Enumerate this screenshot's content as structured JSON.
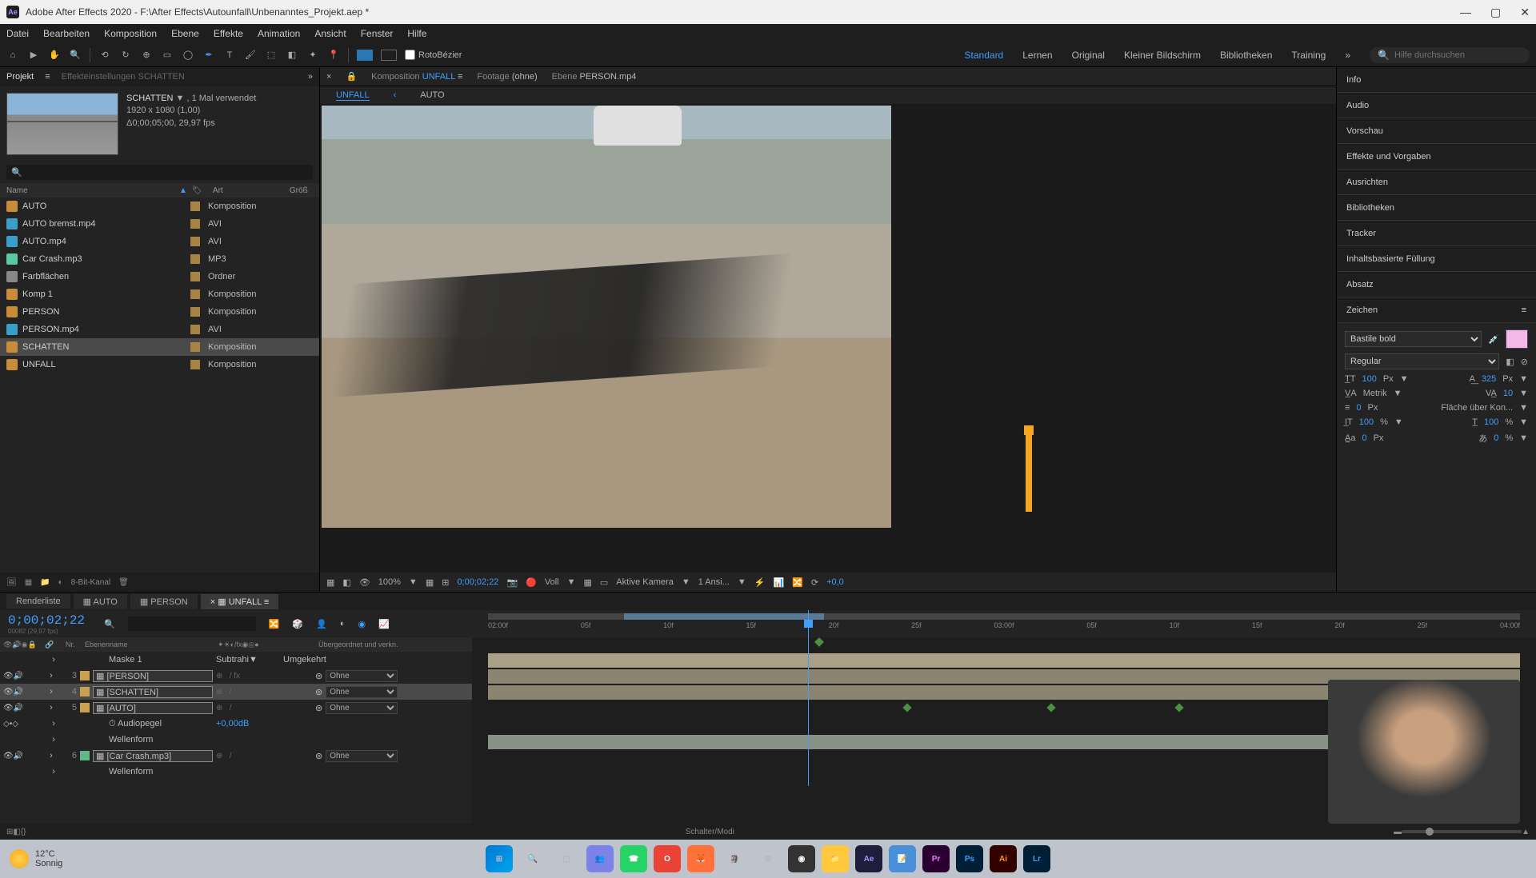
{
  "titlebar": {
    "app": "Ae",
    "title": "Adobe After Effects 2020 - F:\\After Effects\\Autounfall\\Unbenanntes_Projekt.aep *"
  },
  "menu": [
    "Datei",
    "Bearbeiten",
    "Komposition",
    "Ebene",
    "Effekte",
    "Animation",
    "Ansicht",
    "Fenster",
    "Hilfe"
  ],
  "toolbar": {
    "rotobezier": "RotoBézier",
    "workspaces": {
      "items": [
        "Standard",
        "Lernen",
        "Original",
        "Kleiner Bildschirm",
        "Bibliotheken",
        "Training"
      ],
      "active": "Standard"
    },
    "search_placeholder": "Hilfe durchsuchen"
  },
  "project": {
    "tab_label": "Projekt",
    "effect_tab": "Effekteinstellungen SCHATTEN",
    "selected": {
      "name": "SCHATTEN",
      "usage": ", 1 Mal verwendet",
      "res": "1920 x 1080 (1,00)",
      "dur": "Δ0;00;05;00, 29,97 fps"
    },
    "cols": {
      "name": "Name",
      "art": "Art",
      "size": "Größ"
    },
    "items": [
      {
        "name": "AUTO",
        "kind": "comp",
        "art": "Komposition"
      },
      {
        "name": "AUTO bremst.mp4",
        "kind": "vid",
        "art": "AVI"
      },
      {
        "name": "AUTO.mp4",
        "kind": "vid",
        "art": "AVI"
      },
      {
        "name": "Car Crash.mp3",
        "kind": "aud",
        "art": "MP3"
      },
      {
        "name": "Farbflächen",
        "kind": "fold",
        "art": "Ordner"
      },
      {
        "name": "Komp 1",
        "kind": "comp",
        "art": "Komposition"
      },
      {
        "name": "PERSON",
        "kind": "comp",
        "art": "Komposition"
      },
      {
        "name": "PERSON.mp4",
        "kind": "vid",
        "art": "AVI"
      },
      {
        "name": "SCHATTEN",
        "kind": "comp",
        "art": "Komposition",
        "selected": true
      },
      {
        "name": "UNFALL",
        "kind": "comp",
        "art": "Komposition"
      }
    ],
    "footer": "8-Bit-Kanal"
  },
  "composition": {
    "tabs": [
      {
        "label": "Komposition",
        "value": "UNFALL"
      },
      {
        "label": "Footage",
        "value": "(ohne)"
      },
      {
        "label": "Ebene",
        "value": "PERSON.mp4"
      }
    ],
    "subtabs": {
      "active": "UNFALL",
      "other": "AUTO"
    },
    "bar": {
      "zoom": "100%",
      "time": "0;00;02;22",
      "res": "Voll",
      "camera": "Aktive Kamera",
      "views": "1 Ansi...",
      "exposure": "+0,0"
    }
  },
  "panels": [
    "Info",
    "Audio",
    "Vorschau",
    "Effekte und Vorgaben",
    "Ausrichten",
    "Bibliotheken",
    "Tracker",
    "Inhaltsbasierte Füllung",
    "Absatz"
  ],
  "character": {
    "title": "Zeichen",
    "font": "Bastile bold",
    "style": "Regular",
    "size": "100",
    "size_unit": "Px",
    "leading": "325",
    "leading_unit": "Px",
    "kerning": "Metrik",
    "tracking": "10",
    "stroke": "0",
    "stroke_unit": "Px",
    "fill_over": "Fläche über Kon...",
    "vscale": "100",
    "vscale_unit": "%",
    "hscale": "100",
    "hscale_unit": "%",
    "baseline": "0",
    "baseline_unit": "Px",
    "tsume": "0",
    "tsume_unit": "%"
  },
  "timeline": {
    "tabs": [
      "Renderliste",
      "AUTO",
      "PERSON",
      "UNFALL"
    ],
    "active_tab": "UNFALL",
    "timecode": "0;00;02;22",
    "frames": "00082 (29,97 fps)",
    "col_layer": "Ebenenname",
    "col_parent": "Übergeordnet und verkn.",
    "col_nr": "Nr.",
    "ruler": [
      "02:00f",
      "05f",
      "10f",
      "15f",
      "20f",
      "25f",
      "03:00f",
      "05f",
      "10f",
      "15f",
      "20f",
      "25f",
      "04:00f"
    ],
    "layers": [
      {
        "idx": "",
        "name": "Maske 1",
        "mode": "Subtrahi",
        "inv": "Umgekehrt",
        "color": "#b89048",
        "indent": true
      },
      {
        "idx": "3",
        "name": "[PERSON]",
        "parent": "Ohne",
        "color": "#c8a050",
        "boxed": true,
        "fx": true
      },
      {
        "idx": "4",
        "name": "[SCHATTEN]",
        "parent": "Ohne",
        "color": "#c8a050",
        "boxed": true,
        "selected": true
      },
      {
        "idx": "5",
        "name": "[AUTO]",
        "parent": "Ohne",
        "color": "#c8a050",
        "boxed": true
      },
      {
        "idx": "",
        "name": "Audiopegel",
        "value": "+0,00dB",
        "indent": true,
        "stopwatch": true
      },
      {
        "idx": "",
        "name": "Wellenform",
        "indent": true
      },
      {
        "idx": "6",
        "name": "[Car Crash.mp3]",
        "parent": "Ohne",
        "color": "#60b888",
        "boxed": true
      },
      {
        "idx": "",
        "name": "Wellenform",
        "indent": true
      }
    ],
    "footer": "Schalter/Modi"
  },
  "taskbar": {
    "temp": "12°C",
    "cond": "Sonnig"
  }
}
